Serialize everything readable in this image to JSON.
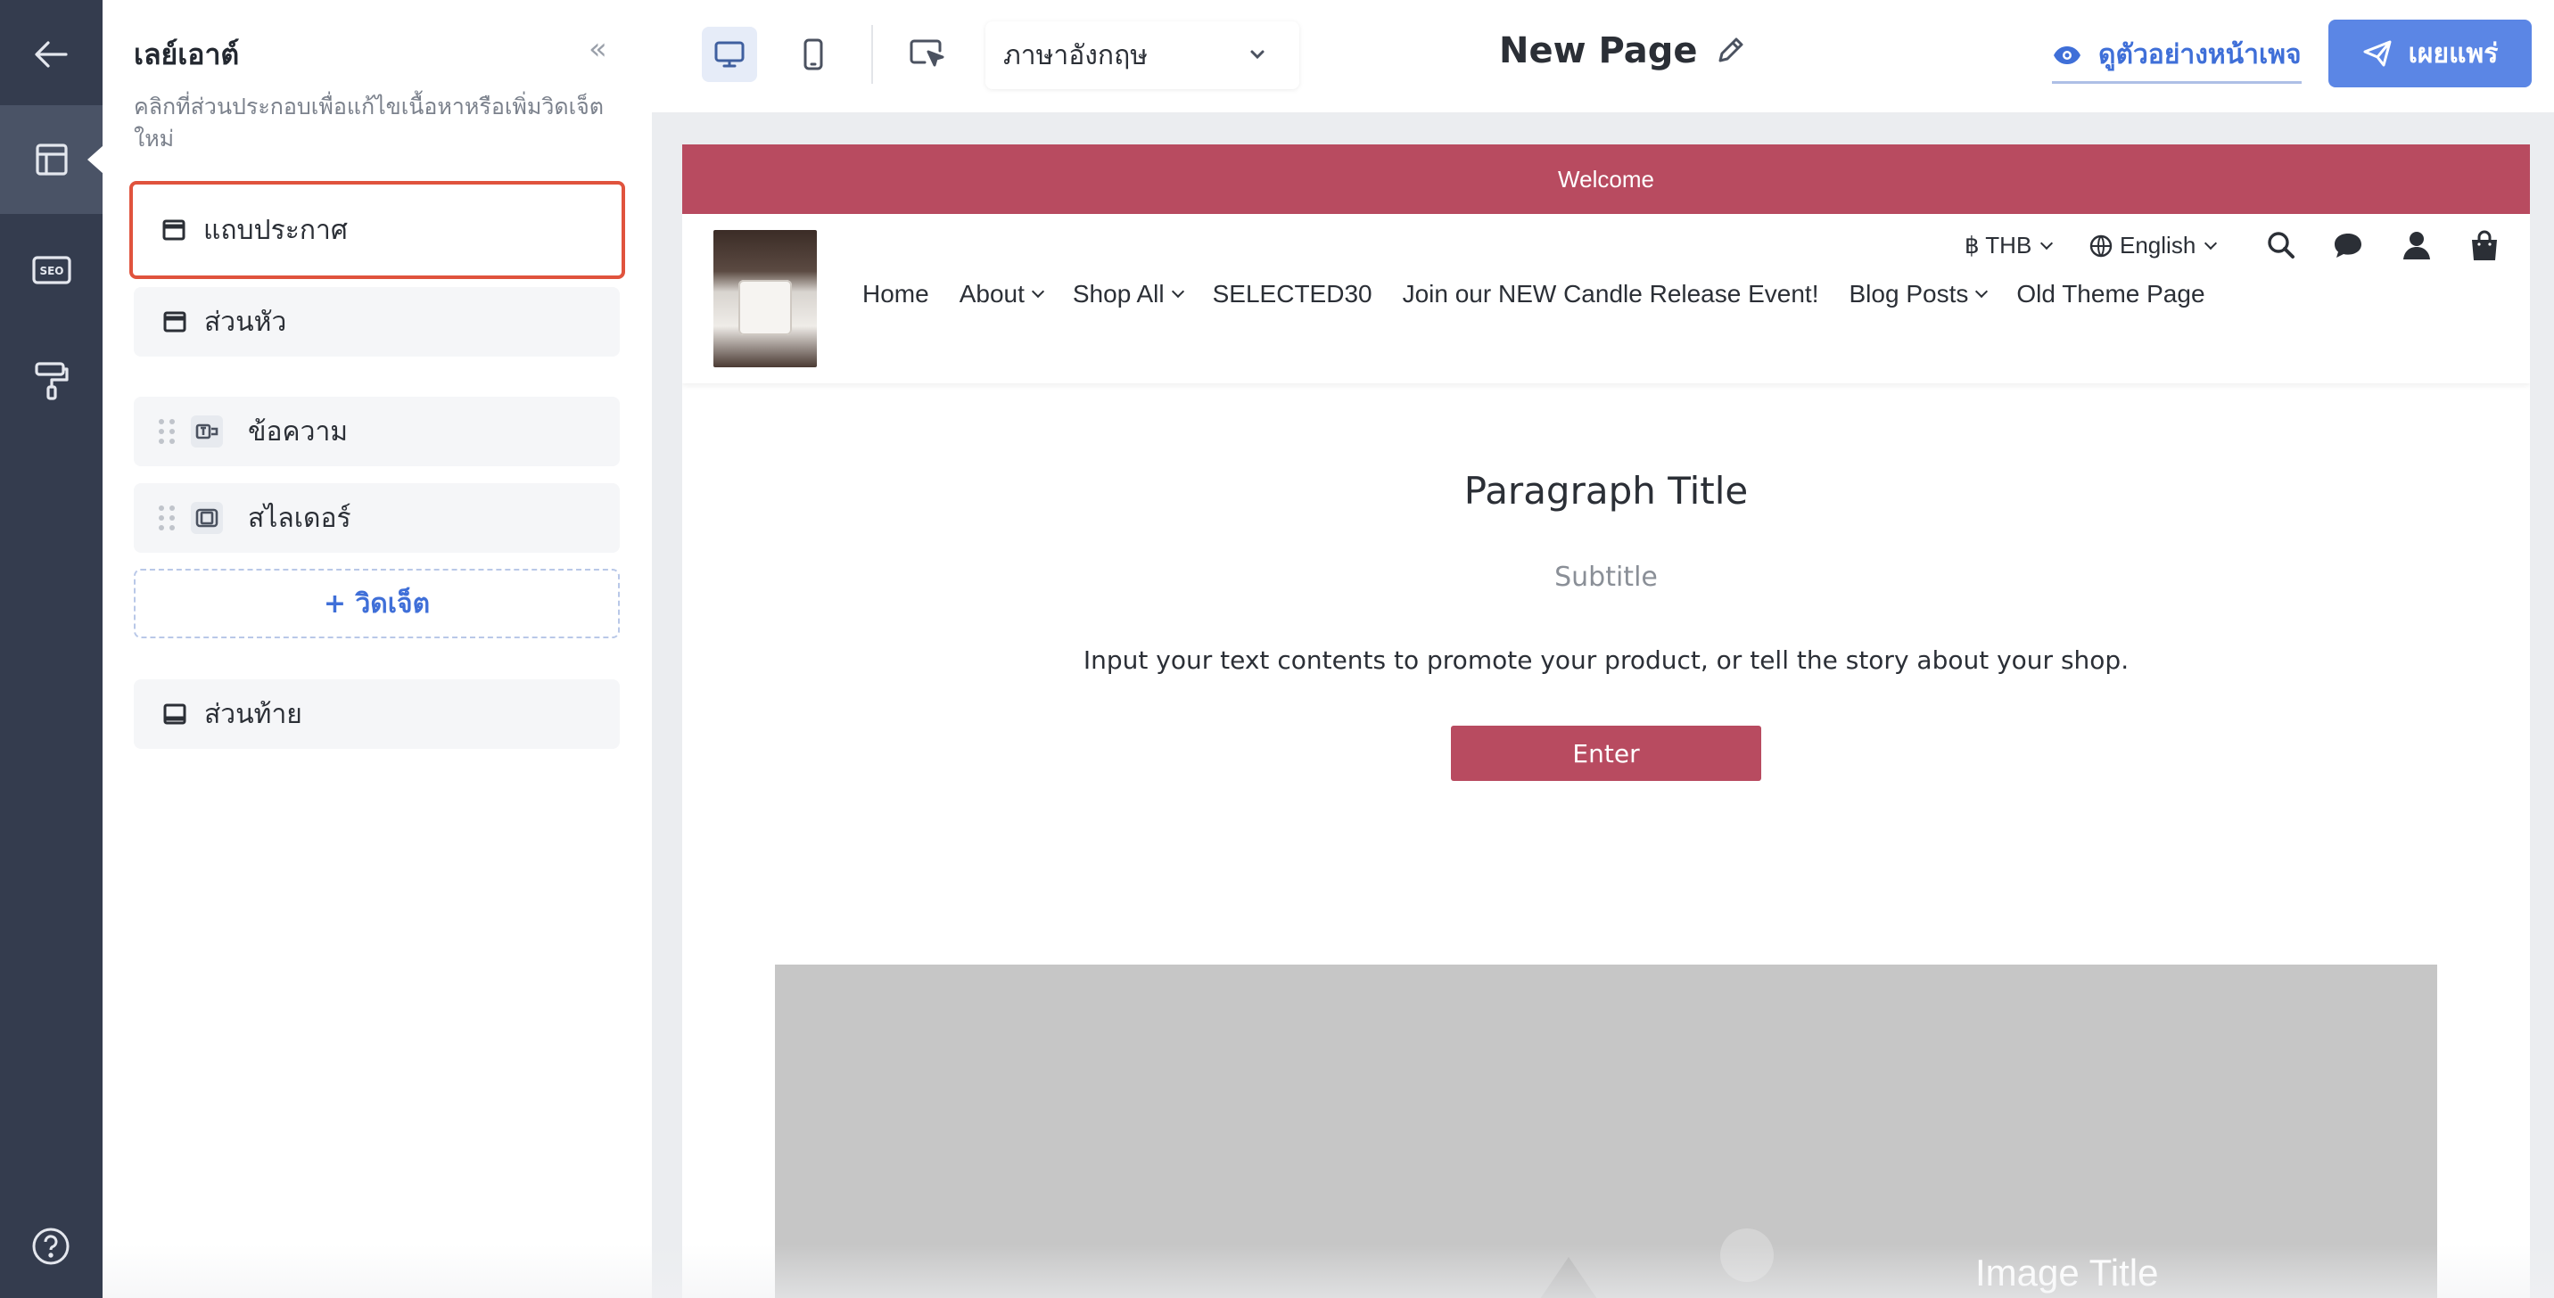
{
  "rail": {
    "items": [
      {
        "icon": "back-arrow-icon"
      },
      {
        "icon": "layout-icon"
      },
      {
        "icon": "seo-icon",
        "label": "SEO"
      },
      {
        "icon": "paint-roller-icon"
      }
    ],
    "help_icon": "help-circle-icon"
  },
  "panel": {
    "title": "เลย์เอาต์",
    "collapse_label": "«",
    "description": "คลิกที่ส่วนประกอบเพื่อแก้ไขเนื้อหาหรือเพิ่มวิดเจ็ตใหม่",
    "sections": {
      "announcement": "แถบประกาศ",
      "header": "ส่วนหัว",
      "footer": "ส่วนท้าย"
    },
    "widgets": [
      {
        "label": "ข้อความ",
        "icon": "text-widget-icon"
      },
      {
        "label": "สไลเดอร์",
        "icon": "slider-widget-icon"
      }
    ],
    "add_widget_label": "+ วิดเจ็ต"
  },
  "toolbar": {
    "language_value": "ภาษาอังกฤษ",
    "page_title": "New Page",
    "preview_label": "ดูตัวอย่างหน้าเพจ",
    "publish_label": "เผยแพร่"
  },
  "canvas": {
    "announcement_text": "Welcome",
    "currency": "฿ THB",
    "language": "English",
    "nav": [
      {
        "label": "Home",
        "dropdown": false
      },
      {
        "label": "About",
        "dropdown": true
      },
      {
        "label": "Shop All",
        "dropdown": true
      },
      {
        "label": "SELECTED30",
        "dropdown": false
      },
      {
        "label": "Join our NEW Candle Release Event!",
        "dropdown": false
      },
      {
        "label": "Blog Posts",
        "dropdown": true
      },
      {
        "label": "Old Theme Page",
        "dropdown": false
      }
    ],
    "paragraph": {
      "title": "Paragraph Title",
      "subtitle": "Subtitle",
      "body": "Input your text contents to promote your product, or tell the story about your shop.",
      "button": "Enter"
    },
    "slider": {
      "image_title": "Image Title"
    }
  },
  "colors": {
    "accent": "#b84b60",
    "primary": "#5b86e5",
    "rail": "#343c4e",
    "selection": "#e0533d"
  }
}
